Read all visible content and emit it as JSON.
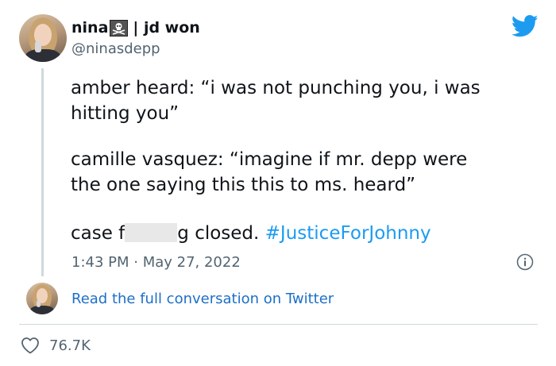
{
  "tweet": {
    "display_name_prefix": "nina",
    "display_name_suffix": "| jd won",
    "handle": "@ninasdepp",
    "paragraph1_line1": "amber heard: “i was not punching you, i was",
    "paragraph1_line2": "hitting you”",
    "paragraph2_line1": "camille vasquez: “imagine if mr. depp were",
    "paragraph2_line2": "the one saying this this to ms. heard”",
    "paragraph3_before": "case f",
    "paragraph3_after": "g closed. ",
    "hashtag": "#JusticeForJohnny",
    "timestamp": "1:43 PM · May 27, 2022",
    "read_more": "Read the full conversation on Twitter",
    "like_count": "76.7K"
  },
  "icons": {
    "brand": "twitter-bird-icon",
    "badge": "skull-and-crossbones-icon",
    "info": "info-icon",
    "like": "heart-icon"
  },
  "colors": {
    "accent": "#1d9bf0",
    "link": "#1d6fc8",
    "muted": "#536471",
    "text": "#0f1419"
  }
}
